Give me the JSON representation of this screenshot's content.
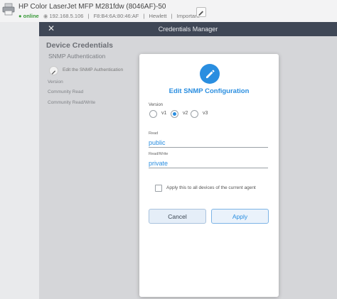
{
  "device": {
    "name": "HP Color LaserJet MFP M281fdw (8046AF)-50",
    "status": "online",
    "ip": "192.168.5.106",
    "mac": "F8:B4:6A:80:46:AF",
    "manufacturer": "Hewlett",
    "tag": "Important"
  },
  "credentials_manager": {
    "title": "Credentials Manager",
    "heading": "Device Credentials",
    "snmp_section": "SNMP Authentication",
    "edit_label": "Edit the SNMP Authentication",
    "rows": [
      "Version",
      "Community Read",
      "Community Read/Write"
    ]
  },
  "modal": {
    "title": "Edit SNMP Configuration",
    "version_label": "Version",
    "versions": [
      {
        "label": "v1",
        "checked": false
      },
      {
        "label": "v2",
        "checked": true
      },
      {
        "label": "v3",
        "checked": false
      }
    ],
    "read_label": "Read",
    "read_value": "public",
    "readwrite_label": "Read/Write",
    "readwrite_value": "private",
    "apply_all_label": "Apply this to all devices of the current agent",
    "apply_all_checked": false,
    "cancel_label": "Cancel",
    "apply_label": "Apply"
  },
  "colors": {
    "accent": "#2a8ee0",
    "header_bar": "#3f4756",
    "online": "#3a9a3a"
  },
  "icons": {
    "printer": "printer-icon",
    "edit": "pencil-icon",
    "close": "close-icon"
  }
}
